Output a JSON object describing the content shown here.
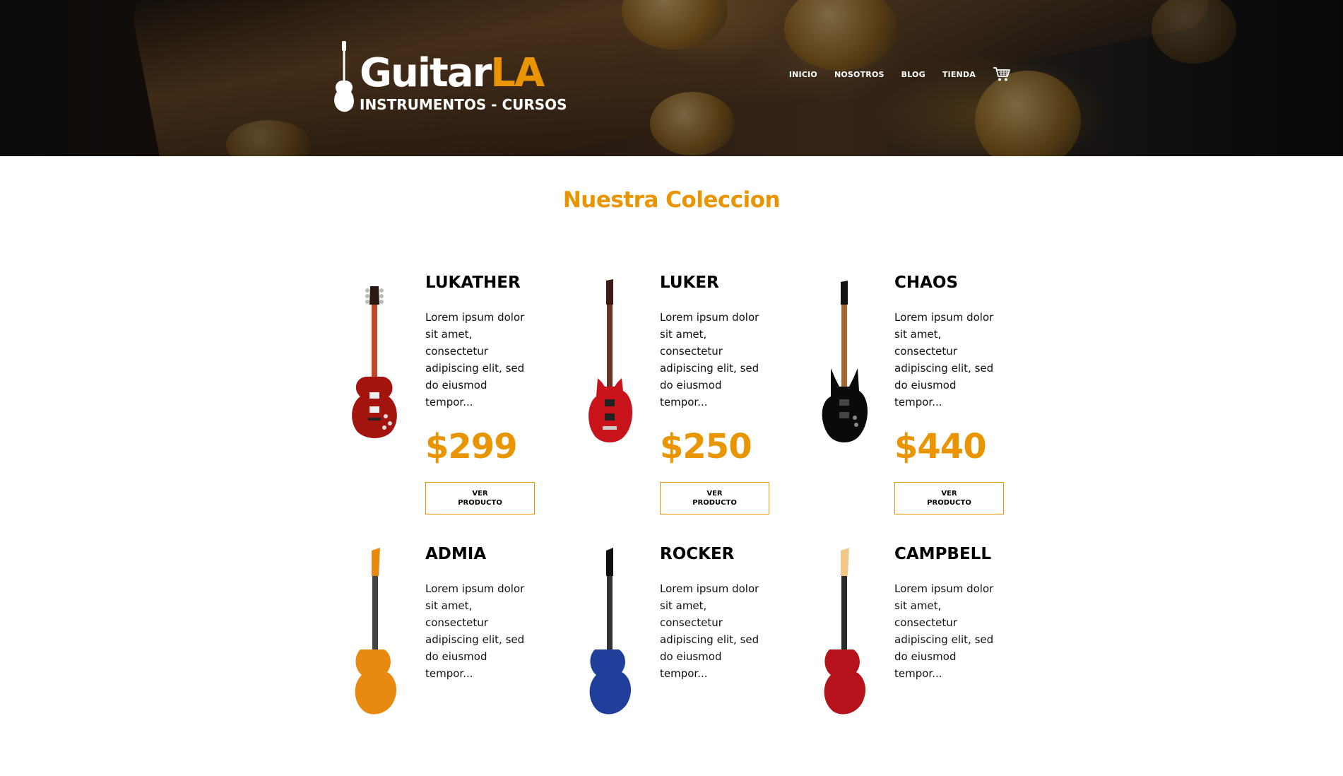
{
  "header": {
    "logo": {
      "name_main": "Guitar",
      "name_accent": "LA",
      "subtitle": "INSTRUMENTOS - CURSOS"
    },
    "nav": [
      {
        "label": "INICIO"
      },
      {
        "label": "NOSOTROS"
      },
      {
        "label": "BLOG"
      },
      {
        "label": "TIENDA"
      }
    ],
    "cart_icon": "shopping-cart-icon"
  },
  "main": {
    "title": "Nuestra Coleccion",
    "products": [
      {
        "name": "LUKATHER",
        "description": "Lorem ipsum dolor sit amet, consectetur adipiscing elit, sed do eiusmod tempor...",
        "price": "$299",
        "button_label": "VER PRODUCTO",
        "guitar_color": "#a4140f",
        "style": "les-paul"
      },
      {
        "name": "LUKER",
        "description": "Lorem ipsum dolor sit amet, consectetur adipiscing elit, sed do eiusmod tempor...",
        "price": "$250",
        "button_label": "VER PRODUCTO",
        "guitar_color": "#c8131b",
        "style": "superstrat"
      },
      {
        "name": "CHAOS",
        "description": "Lorem ipsum dolor sit amet, consectetur adipiscing elit, sed do eiusmod tempor...",
        "price": "$440",
        "button_label": "VER PRODUCTO",
        "guitar_color": "#0a0a0a",
        "style": "superstrat"
      },
      {
        "name": "ADMIA",
        "description": "Lorem ipsum dolor sit amet, consectetur adipiscing elit, sed do eiusmod tempor...",
        "price": "",
        "button_label": "",
        "guitar_color": "#e98a10",
        "style": "strat"
      },
      {
        "name": "ROCKER",
        "description": "Lorem ipsum dolor sit amet, consectetur adipiscing elit, sed do eiusmod tempor...",
        "price": "",
        "button_label": "",
        "guitar_color": "#1f3f9a",
        "style": "superstrat"
      },
      {
        "name": "CAMPBELL",
        "description": "Lorem ipsum dolor sit amet, consectetur adipiscing elit, sed do eiusmod tempor...",
        "price": "",
        "button_label": "",
        "guitar_color": "#b5121b",
        "style": "strat"
      }
    ]
  },
  "colors": {
    "accent": "#e99401",
    "text": "#000000",
    "header_text": "#ffffff"
  }
}
